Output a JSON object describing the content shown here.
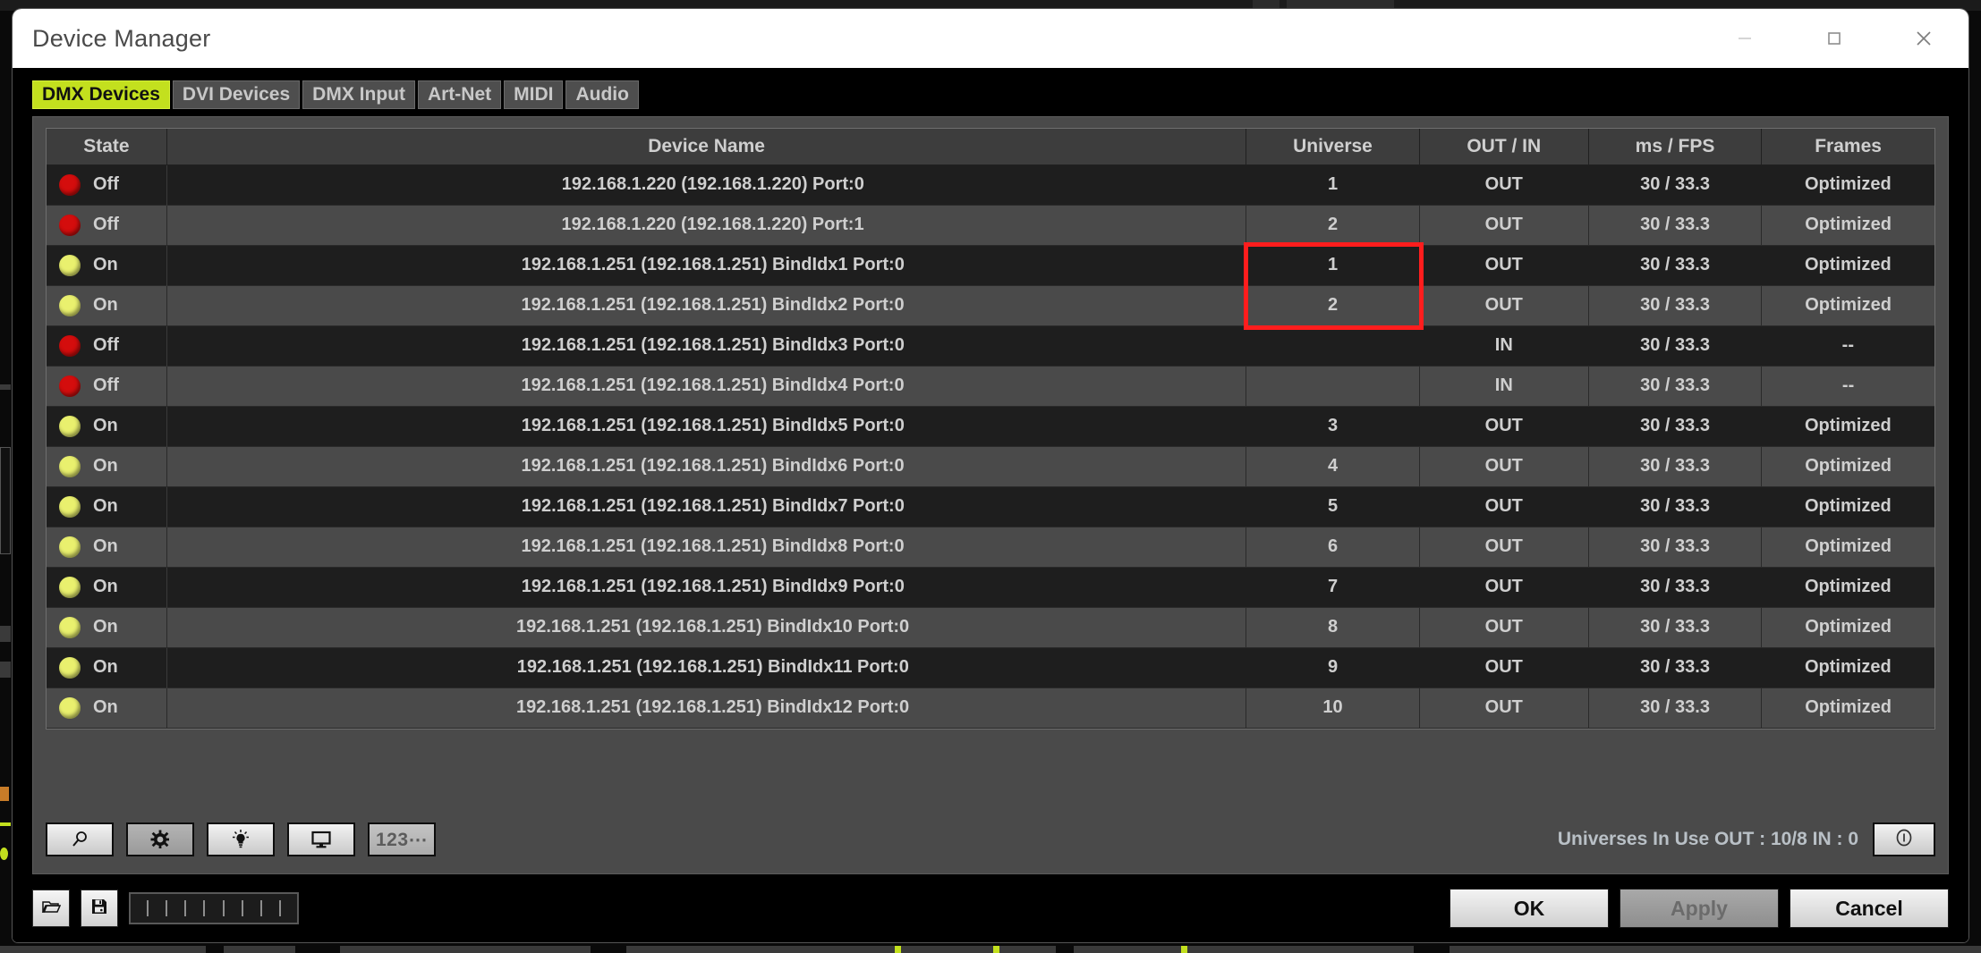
{
  "window": {
    "title": "Device Manager",
    "controls": [
      {
        "name": "minimize-button",
        "glyph": "minimize"
      },
      {
        "name": "maximize-button",
        "glyph": "maximize"
      },
      {
        "name": "close-button",
        "glyph": "close"
      }
    ]
  },
  "tabs": [
    {
      "label": "DMX Devices",
      "active": true
    },
    {
      "label": "DVI Devices",
      "active": false
    },
    {
      "label": "DMX Input",
      "active": false
    },
    {
      "label": "Art-Net",
      "active": false
    },
    {
      "label": "MIDI",
      "active": false
    },
    {
      "label": "Audio",
      "active": false
    }
  ],
  "table": {
    "columns": [
      "State",
      "Device Name",
      "Universe",
      "OUT / IN",
      "ms / FPS",
      "Frames"
    ],
    "rows": [
      {
        "state": "Off",
        "led": "off",
        "name": "192.168.1.220 (192.168.1.220) Port:0",
        "universe": "1",
        "outin": "OUT",
        "ms": "30 / 33.3",
        "frames": "Optimized"
      },
      {
        "state": "Off",
        "led": "off",
        "name": "192.168.1.220 (192.168.1.220) Port:1",
        "universe": "2",
        "outin": "OUT",
        "ms": "30 / 33.3",
        "frames": "Optimized"
      },
      {
        "state": "On",
        "led": "on",
        "name": "192.168.1.251 (192.168.1.251) BindIdx1 Port:0",
        "universe": "1",
        "outin": "OUT",
        "ms": "30 / 33.3",
        "frames": "Optimized"
      },
      {
        "state": "On",
        "led": "on",
        "name": "192.168.1.251 (192.168.1.251) BindIdx2 Port:0",
        "universe": "2",
        "outin": "OUT",
        "ms": "30 / 33.3",
        "frames": "Optimized"
      },
      {
        "state": "Off",
        "led": "off",
        "name": "192.168.1.251 (192.168.1.251) BindIdx3 Port:0",
        "universe": "",
        "outin": "IN",
        "ms": "30 / 33.3",
        "frames": "--"
      },
      {
        "state": "Off",
        "led": "off",
        "name": "192.168.1.251 (192.168.1.251) BindIdx4 Port:0",
        "universe": "",
        "outin": "IN",
        "ms": "30 / 33.3",
        "frames": "--"
      },
      {
        "state": "On",
        "led": "on",
        "name": "192.168.1.251 (192.168.1.251) BindIdx5 Port:0",
        "universe": "3",
        "outin": "OUT",
        "ms": "30 / 33.3",
        "frames": "Optimized"
      },
      {
        "state": "On",
        "led": "on",
        "name": "192.168.1.251 (192.168.1.251) BindIdx6 Port:0",
        "universe": "4",
        "outin": "OUT",
        "ms": "30 / 33.3",
        "frames": "Optimized"
      },
      {
        "state": "On",
        "led": "on",
        "name": "192.168.1.251 (192.168.1.251) BindIdx7 Port:0",
        "universe": "5",
        "outin": "OUT",
        "ms": "30 / 33.3",
        "frames": "Optimized"
      },
      {
        "state": "On",
        "led": "on",
        "name": "192.168.1.251 (192.168.1.251) BindIdx8 Port:0",
        "universe": "6",
        "outin": "OUT",
        "ms": "30 / 33.3",
        "frames": "Optimized"
      },
      {
        "state": "On",
        "led": "on",
        "name": "192.168.1.251 (192.168.1.251) BindIdx9 Port:0",
        "universe": "7",
        "outin": "OUT",
        "ms": "30 / 33.3",
        "frames": "Optimized"
      },
      {
        "state": "On",
        "led": "on",
        "name": "192.168.1.251 (192.168.1.251) BindIdx10 Port:0",
        "universe": "8",
        "outin": "OUT",
        "ms": "30 / 33.3",
        "frames": "Optimized"
      },
      {
        "state": "On",
        "led": "on",
        "name": "192.168.1.251 (192.168.1.251) BindIdx11 Port:0",
        "universe": "9",
        "outin": "OUT",
        "ms": "30 / 33.3",
        "frames": "Optimized"
      },
      {
        "state": "On",
        "led": "on",
        "name": "192.168.1.251 (192.168.1.251) BindIdx12 Port:0",
        "universe": "10",
        "outin": "OUT",
        "ms": "30 / 33.3",
        "frames": "Optimized"
      }
    ]
  },
  "annotation": {
    "color": "#ff1d1d",
    "target": "universe-cells-rows-3-4"
  },
  "toolbar": {
    "buttons": [
      {
        "name": "search-icon",
        "label": ""
      },
      {
        "name": "gear-icon",
        "label": ""
      },
      {
        "name": "lightbulb-icon",
        "label": ""
      },
      {
        "name": "monitor-icon",
        "label": ""
      },
      {
        "name": "numbers-icon",
        "label": "123⋯"
      }
    ],
    "status": "Universes In Use OUT : 10/8  IN : 0",
    "info_button": "info-icon"
  },
  "bottombar": {
    "open_icon": "folder-open-icon",
    "save_icon": "floppy-disk-icon",
    "actions": [
      {
        "label": "OK",
        "disabled": false
      },
      {
        "label": "Apply",
        "disabled": true
      },
      {
        "label": "Cancel",
        "disabled": false
      }
    ]
  }
}
